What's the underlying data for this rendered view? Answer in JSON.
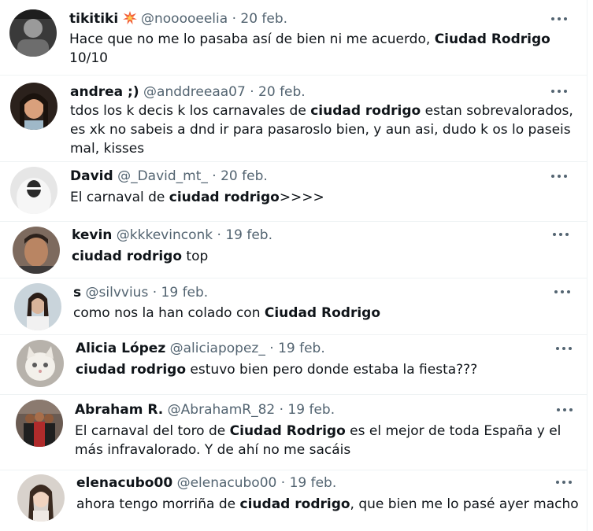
{
  "tweets": [
    {
      "name": "tikitiki",
      "badge_icon": "collision-emoji",
      "handle": "@nooooeelia",
      "sep": "·",
      "date": "20 feb.",
      "text": [
        {
          "t": "Hace que no me lo pasaba así de bien ni me acuerdo, ",
          "b": false
        },
        {
          "t": "Ciudad Rodrigo",
          "b": true
        },
        {
          "t": " 10/10",
          "b": false
        }
      ]
    },
    {
      "name": "andrea ;)",
      "handle": "@anddreeaa07",
      "sep": "·",
      "date": "20 feb.",
      "text": [
        {
          "t": "tdos los k decis k los carnavales de ",
          "b": false
        },
        {
          "t": "ciudad rodrigo",
          "b": true
        },
        {
          "t": " estan sobrevalorados, es xk no sabeis a dnd ir para pasaroslo bien, y aun asi, dudo k os lo paseis mal, kisses",
          "b": false
        }
      ]
    },
    {
      "name": "David",
      "handle": "@_David_mt_",
      "sep": "·",
      "date": "20 feb.",
      "text": [
        {
          "t": "El carnaval de ",
          "b": false
        },
        {
          "t": "ciudad rodrigo",
          "b": true
        },
        {
          "t": ">>>>",
          "b": false
        }
      ]
    },
    {
      "name": "kevin",
      "handle": "@kkkevinconk",
      "sep": "·",
      "date": "19 feb.",
      "text": [
        {
          "t": "ciudad rodrigo",
          "b": true
        },
        {
          "t": " top",
          "b": false
        }
      ]
    },
    {
      "name": "s",
      "handle": "@silvvius",
      "sep": "·",
      "date": "19 feb.",
      "text": [
        {
          "t": "como nos la han colado con ",
          "b": false
        },
        {
          "t": "Ciudad Rodrigo",
          "b": true
        }
      ]
    },
    {
      "name": "Alicia López",
      "handle": "@aliciapopez_",
      "sep": "·",
      "date": "19 feb.",
      "text": [
        {
          "t": "ciudad rodrigo",
          "b": true
        },
        {
          "t": " estuvo bien pero donde estaba la fiesta???",
          "b": false
        }
      ]
    },
    {
      "name": "Abraham R.",
      "handle": "@AbrahamR_82",
      "sep": "·",
      "date": "19 feb.",
      "text": [
        {
          "t": "El carnaval del toro de ",
          "b": false
        },
        {
          "t": "Ciudad Rodrigo",
          "b": true
        },
        {
          "t": " es el mejor de toda España y el más infravalorado. Y de ahí no me sacáis",
          "b": false
        }
      ]
    },
    {
      "name": "elenacubo00",
      "handle": "@elenacubo00",
      "sep": "·",
      "date": "19 feb.",
      "text": [
        {
          "t": "ahora tengo morriña de ",
          "b": false
        },
        {
          "t": "ciudad rodrigo",
          "b": true
        },
        {
          "t": ", que bien me lo pasé ayer macho",
          "b": false
        }
      ]
    }
  ]
}
